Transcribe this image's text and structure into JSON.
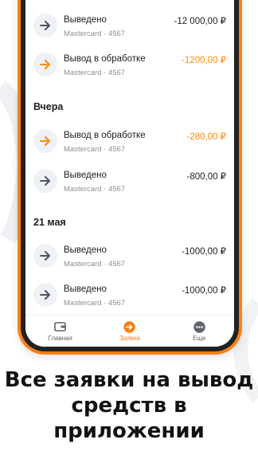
{
  "sections": [
    {
      "title": "",
      "items": [
        {
          "title": "Выведено",
          "sub": "Mastercard · 4567",
          "amount": "-12 000,00 ₽",
          "status": "done"
        },
        {
          "title": "Вывод в обработке",
          "sub": "Mastercard · 4567",
          "amount": "-1200,00 ₽",
          "status": "pending"
        }
      ]
    },
    {
      "title": "Вчера",
      "items": [
        {
          "title": "Вывод в обработке",
          "sub": "Mastercard · 4567",
          "amount": "-280,00 ₽",
          "status": "pending"
        },
        {
          "title": "Выведено",
          "sub": "Mastercard · 4567",
          "amount": "-800,00 ₽",
          "status": "done"
        }
      ]
    },
    {
      "title": "21 мая",
      "items": [
        {
          "title": "Выведено",
          "sub": "Mastercard · 4567",
          "amount": "-1000,00 ₽",
          "status": "done"
        },
        {
          "title": "Выведено",
          "sub": "Mastercard · 4567",
          "amount": "-1000,00 ₽",
          "status": "done"
        }
      ]
    }
  ],
  "tabbar": {
    "home": {
      "label": "Главная",
      "icon": "wallet-icon"
    },
    "requests": {
      "label": "Заявки",
      "icon": "arrow-right-circle-icon"
    },
    "more": {
      "label": "Еще",
      "icon": "more-dots-icon"
    }
  },
  "caption": "Все заявки на вывод средств в приложении",
  "colors": {
    "accent": "#ff7f14",
    "pending": "#ff8a00",
    "done_arrow": "#4b5560"
  }
}
